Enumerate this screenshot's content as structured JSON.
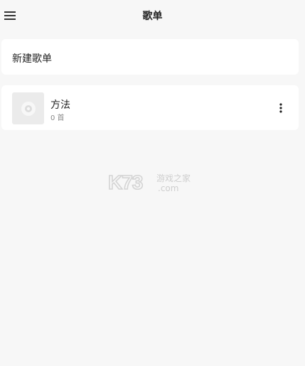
{
  "header": {
    "title": "歌单",
    "menu_icon": "menu-icon"
  },
  "new_playlist": {
    "label": "新建歌单"
  },
  "playlists": [
    {
      "name": "方法",
      "count": "0 首",
      "cover_icon": "disc-icon",
      "more_icon": "more-vertical-icon"
    }
  ],
  "watermark": {
    "brand": "K73",
    "text_top": "游戏之家",
    "text_bottom": ".com"
  },
  "colors": {
    "background": "#f7f7f7",
    "card": "#ffffff",
    "cover": "#ebebeb"
  }
}
